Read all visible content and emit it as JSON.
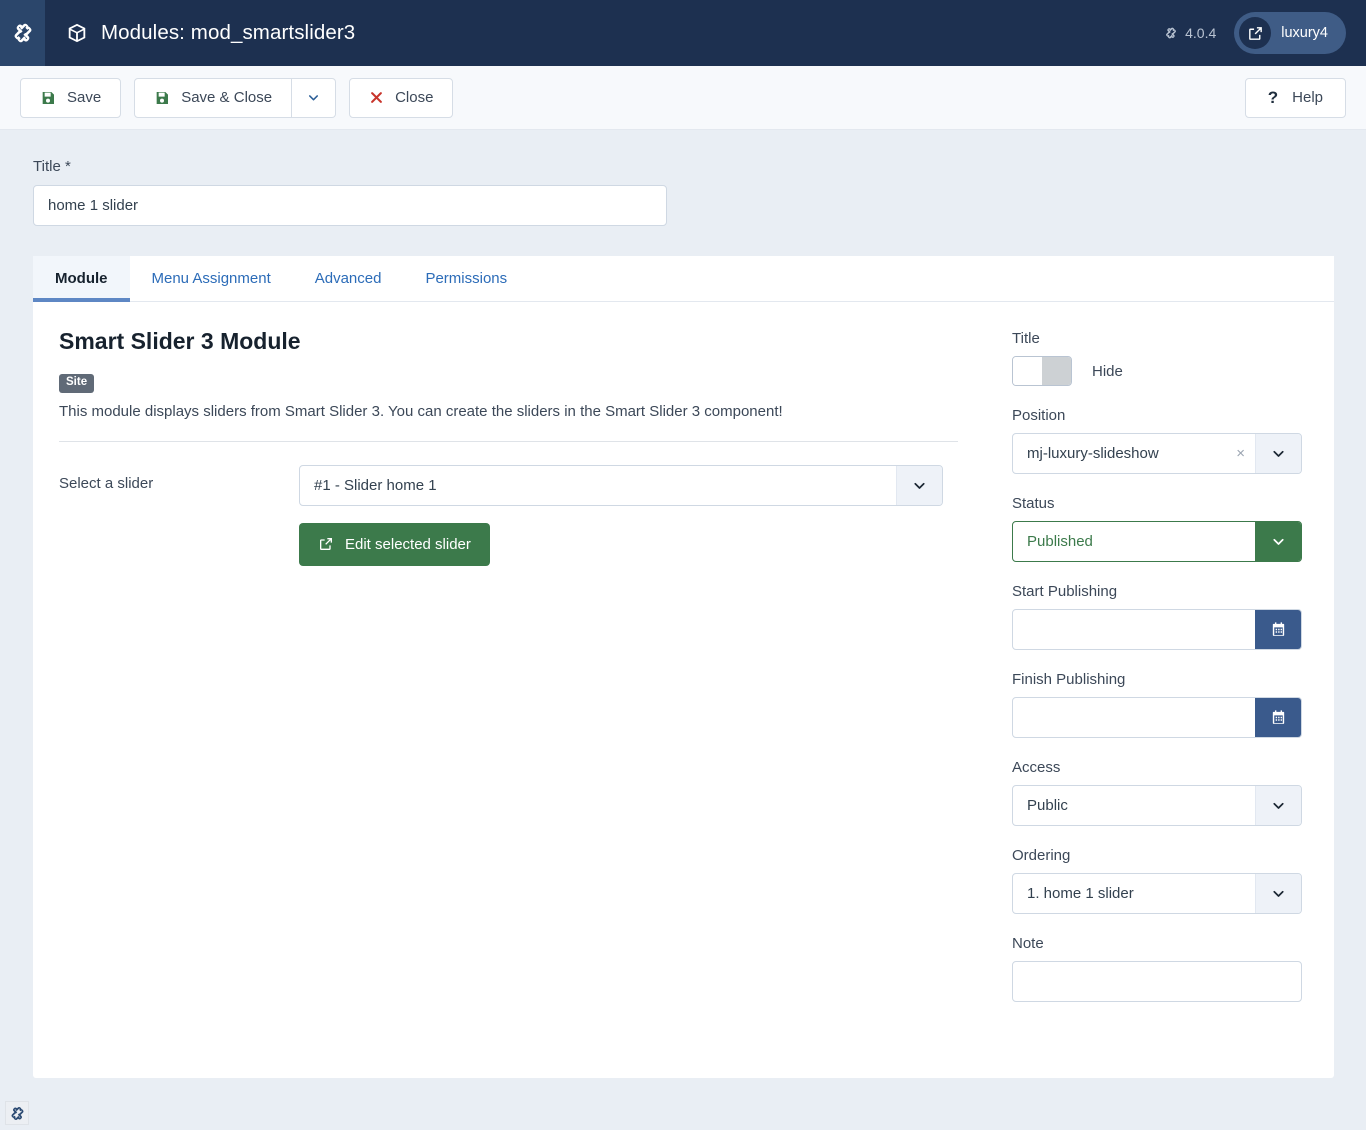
{
  "header": {
    "logo_icon": "joomla-logo-icon",
    "page_icon": "cube-icon",
    "title": "Modules: mod_smartslider3",
    "version_icon": "joomla-mark-icon",
    "version": "4.0.4",
    "site_link_icon": "external-link-icon",
    "site_name": "luxury4"
  },
  "toolbar": {
    "save_label": "Save",
    "save_icon": "floppy-disk-icon",
    "save_close_label": "Save & Close",
    "save_close_icon": "floppy-disk-icon",
    "dropdown_icon": "chevron-down-icon",
    "close_label": "Close",
    "close_icon": "x-mark-icon",
    "help_label": "Help",
    "help_icon": "question-mark-icon"
  },
  "title_field": {
    "label": "Title *",
    "value": "home 1 slider",
    "placeholder": ""
  },
  "tabs": [
    {
      "label": "Module",
      "active": true
    },
    {
      "label": "Menu Assignment",
      "active": false
    },
    {
      "label": "Advanced",
      "active": false
    },
    {
      "label": "Permissions",
      "active": false
    }
  ],
  "module": {
    "heading": "Smart Slider 3 Module",
    "badge": "Site",
    "description": "This module displays sliders from Smart Slider 3. You can create the sliders in the Smart Slider 3 component!",
    "slider_label": "Select a slider",
    "slider_value": "#1 - Slider home 1",
    "slider_arrow_icon": "chevron-down-icon",
    "edit_button_label": "Edit selected slider",
    "edit_button_icon": "external-link-icon",
    "edit_button_color": "#3c7a4b"
  },
  "sidebar": {
    "title": {
      "label": "Title",
      "toggle_state": "off",
      "toggle_label": "Hide"
    },
    "position": {
      "label": "Position",
      "value": "mj-luxury-slideshow",
      "clear_icon": "clear-x-icon",
      "arrow_icon": "chevron-down-icon"
    },
    "status": {
      "label": "Status",
      "value": "Published",
      "arrow_icon": "chevron-down-icon",
      "accent_color": "#3c7a4b"
    },
    "start_publishing": {
      "label": "Start Publishing",
      "value": "",
      "calendar_icon": "calendar-icon"
    },
    "finish_publishing": {
      "label": "Finish Publishing",
      "value": "",
      "calendar_icon": "calendar-icon"
    },
    "access": {
      "label": "Access",
      "value": "Public",
      "arrow_icon": "chevron-down-icon"
    },
    "ordering": {
      "label": "Ordering",
      "value": "1. home 1 slider",
      "arrow_icon": "chevron-down-icon"
    },
    "note": {
      "label": "Note",
      "value": "",
      "placeholder": ""
    }
  },
  "footer": {
    "logo_icon": "joomla-logo-icon"
  }
}
